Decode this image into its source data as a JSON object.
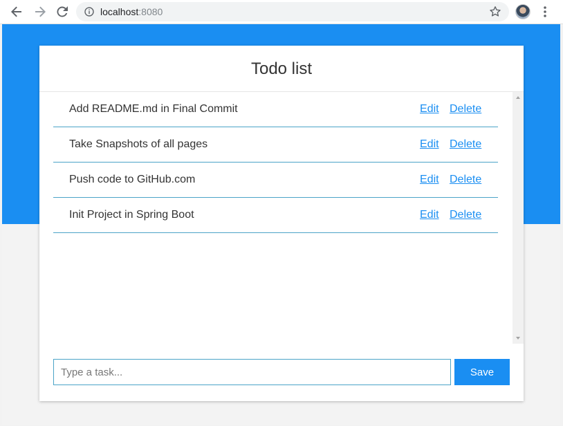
{
  "browser": {
    "url_host": "localhost",
    "url_port": ":8080",
    "icons": {
      "back": "back-arrow-icon",
      "forward": "forward-arrow-icon",
      "reload": "reload-icon",
      "info": "info-icon",
      "star": "star-icon",
      "menu": "kebab-menu-icon"
    }
  },
  "app": {
    "title": "Todo list",
    "todos": [
      {
        "text": "Add README.md in Final Commit",
        "edit_label": "Edit",
        "delete_label": "Delete"
      },
      {
        "text": "Take Snapshots of all pages",
        "edit_label": "Edit",
        "delete_label": "Delete"
      },
      {
        "text": "Push code to GitHub.com",
        "edit_label": "Edit",
        "delete_label": "Delete"
      },
      {
        "text": "Init Project in Spring Boot",
        "edit_label": "Edit",
        "delete_label": "Delete"
      }
    ],
    "input": {
      "placeholder": "Type a task...",
      "value": ""
    },
    "save_label": "Save"
  },
  "colors": {
    "accent": "#1a8ef2",
    "divider": "#4aa3c7",
    "page_background": "#f3f3f3",
    "card_background": "#ffffff"
  }
}
